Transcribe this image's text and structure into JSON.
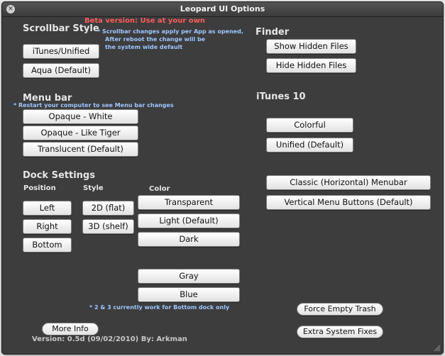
{
  "window": {
    "title": "Leopard UI Options"
  },
  "icons": {
    "close": "close-icon",
    "resize": "resize-grip-icon"
  },
  "colors": {
    "warning": "#ff5a5a",
    "note": "#9ec6ff",
    "window_bg": "#3d3d3d"
  },
  "scrollbar": {
    "heading": "Scrollbar Style",
    "beta_warning": "Beta version: Use at your own",
    "note_line1": "* Scrollbar changes apply per App as opened,",
    "note_line2": "After reboot the change will be",
    "note_line3": "the system wide default",
    "itunes_unified": "iTunes/Unified",
    "aqua_default": "Aqua (Default)"
  },
  "menubar": {
    "heading": "Menu bar",
    "note": "* Restart your computer to see Menu bar changes",
    "opaque_white": "Opaque - White",
    "opaque_tiger": "Opaque - Like Tiger",
    "translucent": "Translucent (Default)"
  },
  "dock": {
    "heading": "Dock Settings",
    "position_label": "Position",
    "style_label": "Style",
    "color_label": "Color",
    "left": "Left",
    "right": "Right",
    "bottom": "Bottom",
    "style_2d": "2D (flat)",
    "style_3d": "3D (shelf)",
    "transparent": "Transparent",
    "light_default": "Light (Default)",
    "dark": "Dark",
    "gray": "Gray",
    "blue": "Blue",
    "note": "* 2 & 3 currently work for Bottom dock only"
  },
  "finder": {
    "heading": "Finder",
    "show_hidden": "Show Hidden Files",
    "hide_hidden": "Hide Hidden Files"
  },
  "itunes": {
    "heading": "iTunes 10",
    "colorful": "Colorful",
    "unified_default": "Unified (Default)",
    "classic_menubar": "Classic (Horizontal) Menubar",
    "vertical_buttons": "Vertical Menu Buttons (Default)"
  },
  "extras": {
    "force_empty_trash": "Force Empty Trash",
    "extra_system_fixes": "Extra System Fixes",
    "more_info": "More Info",
    "version": "Version: 0.5d (09/02/2010)  By: Arkman"
  }
}
